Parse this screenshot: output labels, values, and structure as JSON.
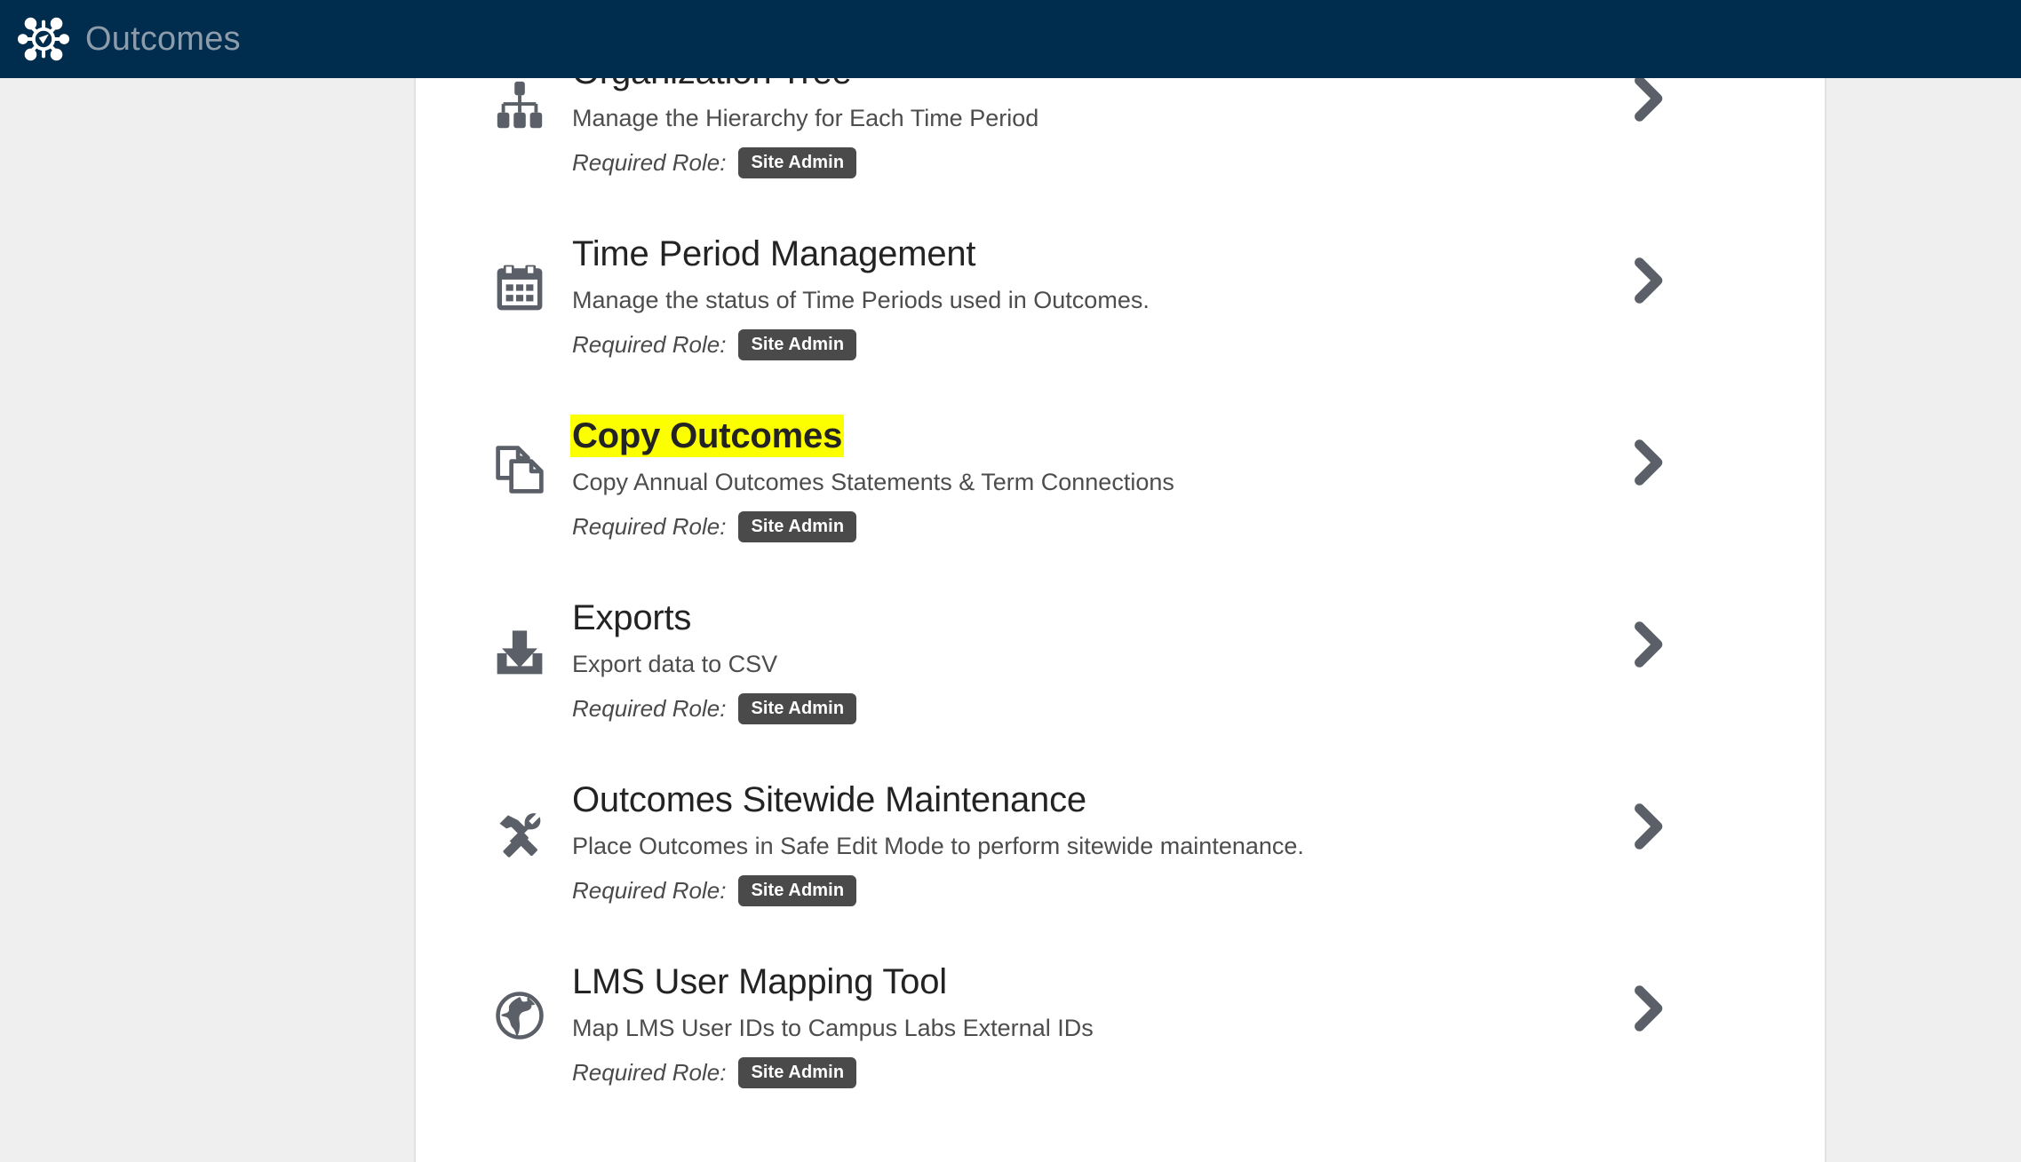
{
  "header": {
    "title": "Outcomes",
    "logo_icon": "outcomes-hub-checkmark-logo",
    "background_color": "#002d4d",
    "title_color": "#8c9cab"
  },
  "theme": {
    "page_background": "#efefef",
    "panel_background": "#ffffff",
    "panel_border": "#e2e2e2",
    "icon_color": "#5b6068",
    "title_color": "#232323",
    "description_color": "#4d4d4d",
    "badge_background": "#4a4a4a",
    "badge_text_color": "#ffffff",
    "highlight_color": "#fbff00",
    "chevron_color": "#5b6068"
  },
  "main": {
    "role_label": "Required Role:",
    "chevron_icon": "chevron-right-icon",
    "items": [
      {
        "title": "Organization Tree",
        "description": "Manage the Hierarchy for Each Time Period",
        "role": "Site Admin",
        "icon": "org-tree-icon",
        "highlighted": false
      },
      {
        "title": "Time Period Management",
        "description": "Manage the status of Time Periods used in Outcomes.",
        "role": "Site Admin",
        "icon": "calendar-icon",
        "highlighted": false
      },
      {
        "title": "Copy Outcomes",
        "description": "Copy Annual Outcomes Statements & Term Connections",
        "role": "Site Admin",
        "icon": "copy-documents-icon",
        "highlighted": true
      },
      {
        "title": "Exports",
        "description": "Export data to CSV",
        "role": "Site Admin",
        "icon": "download-icon",
        "highlighted": false
      },
      {
        "title": "Outcomes Sitewide Maintenance",
        "description": "Place Outcomes in Safe Edit Mode to perform sitewide maintenance.",
        "role": "Site Admin",
        "icon": "hammer-wrench-icon",
        "highlighted": false
      },
      {
        "title": "LMS User Mapping Tool",
        "description": "Map LMS User IDs to Campus Labs External IDs",
        "role": "Site Admin",
        "icon": "globe-icon",
        "highlighted": false
      }
    ]
  }
}
